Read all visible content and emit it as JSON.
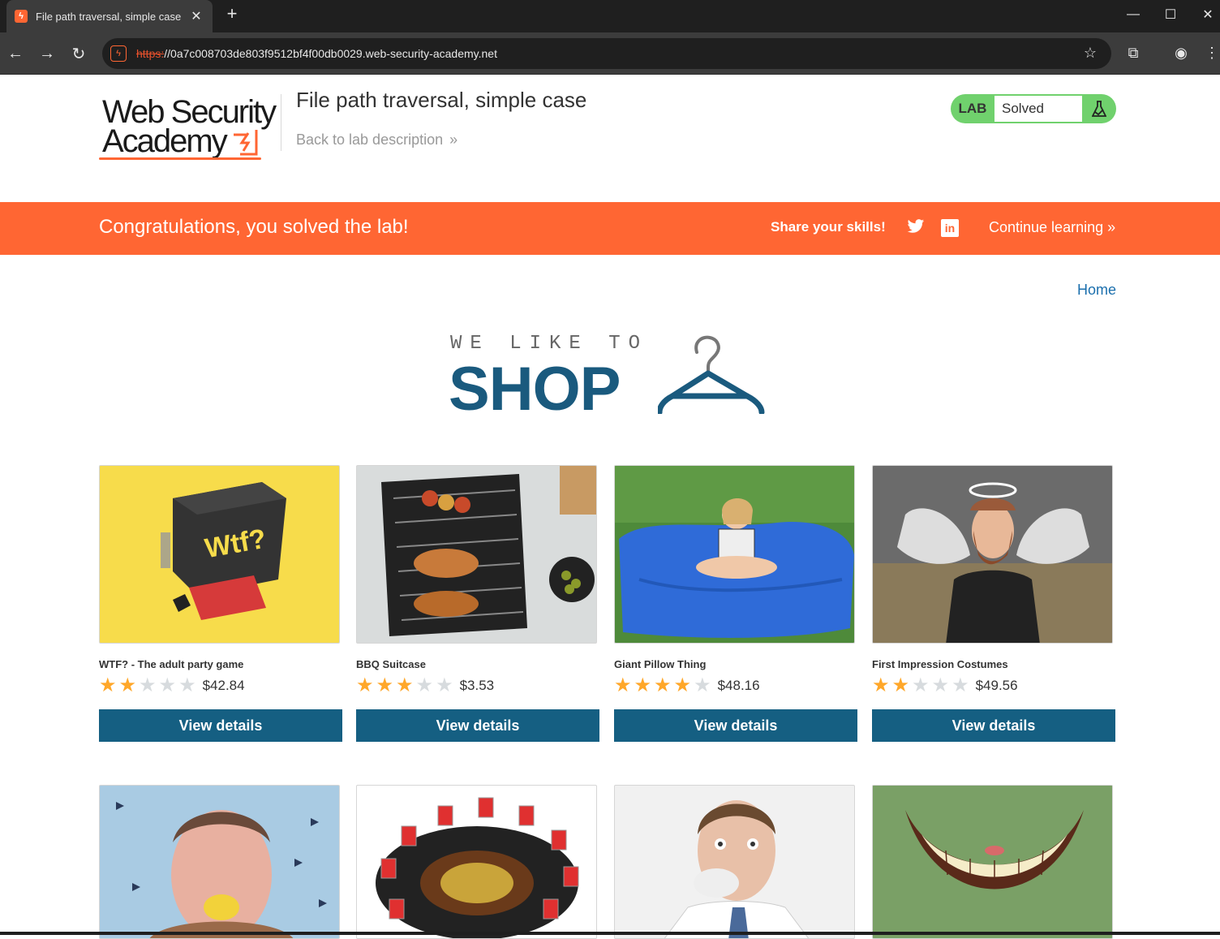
{
  "browser": {
    "tab_title": "File path traversal, simple case",
    "tab_favicon": "burp-lightning-icon",
    "url_scheme": "https:",
    "url_rest": "//0a7c008703de803f9512bf4f00db0029.web-security-academy.net"
  },
  "header": {
    "logo_line1": "Web Security",
    "logo_line2": "Academy",
    "lab_title": "File path traversal, simple case",
    "back_link": "Back to lab description",
    "badge_lab": "LAB",
    "badge_status": "Solved"
  },
  "banner": {
    "message": "Congratulations, you solved the lab!",
    "share": "Share your skills!",
    "continue": "Continue learning"
  },
  "nav": {
    "home": "Home"
  },
  "shop_logo": {
    "small": "WE LIKE TO",
    "big": "SHOP"
  },
  "colors": {
    "accent": "#ff6633",
    "button": "#155f82",
    "badge_green": "#70d16d",
    "star_on": "#ffa729",
    "star_off": "#d7dbde",
    "shop_blue": "#1a5a7e"
  },
  "products": [
    {
      "name": "WTF? - The adult party game",
      "stars": 2,
      "price": "$42.84",
      "button": "View details"
    },
    {
      "name": "BBQ Suitcase",
      "stars": 3,
      "price": "$3.53",
      "button": "View details"
    },
    {
      "name": "Giant Pillow Thing",
      "stars": 4,
      "price": "$48.16",
      "button": "View details"
    },
    {
      "name": "First Impression Costumes",
      "stars": 2,
      "price": "$49.56",
      "button": "View details"
    },
    {
      "name": "",
      "stars": 0,
      "price": "",
      "button": ""
    },
    {
      "name": "",
      "stars": 0,
      "price": "",
      "button": ""
    },
    {
      "name": "",
      "stars": 0,
      "price": "",
      "button": ""
    },
    {
      "name": "",
      "stars": 0,
      "price": "",
      "button": ""
    }
  ]
}
